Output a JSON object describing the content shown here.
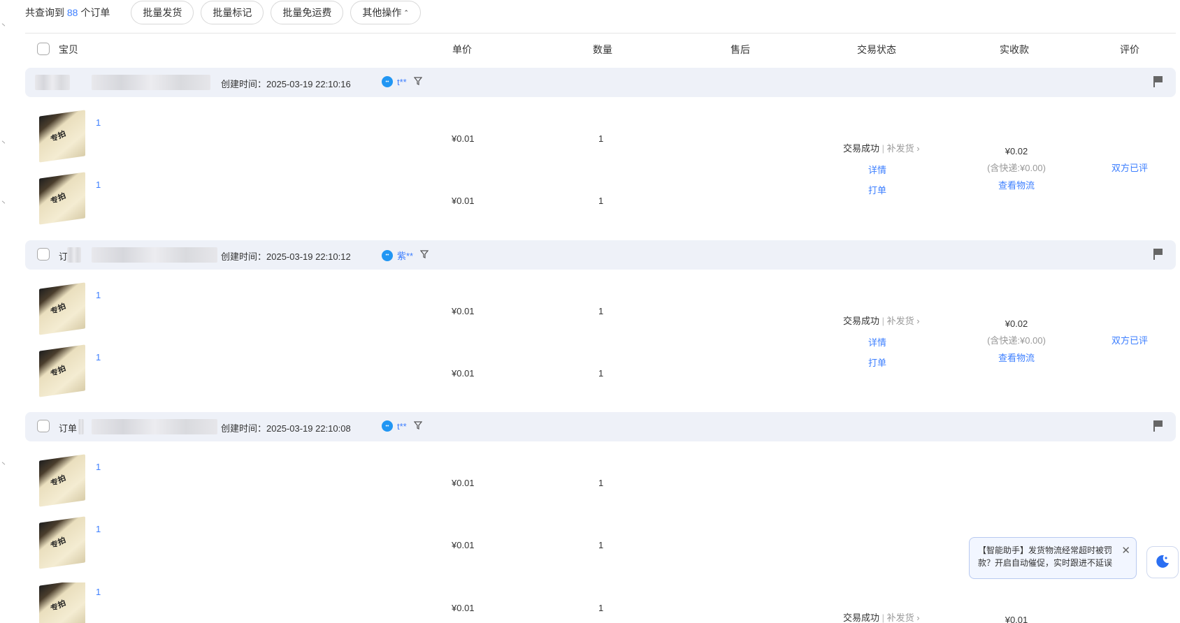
{
  "summary": {
    "prefix": "共查询到",
    "count": "88",
    "suffix": "个订单"
  },
  "toolbar": {
    "bulk_ship": "批量发货",
    "bulk_mark": "批量标记",
    "bulk_free_shipping": "批量免运费",
    "other_ops": "其他操作"
  },
  "columns": {
    "item": "宝贝",
    "unit_price": "单价",
    "quantity": "数量",
    "after_sale": "售后",
    "trade_status": "交易状态",
    "paid": "实收款",
    "review": "评价"
  },
  "orders": [
    {
      "order_label": "",
      "created": "创建时间：2025-03-19 22:10:16",
      "buyer": "t**",
      "items": [
        {
          "title": "1",
          "price": "¥0.01",
          "qty": "1"
        },
        {
          "title": "1",
          "price": "¥0.01",
          "qty": "1"
        }
      ],
      "status": "交易成功",
      "status_sep": "|",
      "status_sub": "补发货",
      "detail": "详情",
      "print": "打单",
      "amount": "¥0.02",
      "shipping": "(含快递:¥0.00)",
      "logistics": "查看物流",
      "review": "双方已评"
    },
    {
      "order_label": "订",
      "created": "创建时间：2025-03-19 22:10:12",
      "buyer": "紫**",
      "items": [
        {
          "title": "1",
          "price": "¥0.01",
          "qty": "1"
        },
        {
          "title": "1",
          "price": "¥0.01",
          "qty": "1"
        }
      ],
      "status": "交易成功",
      "status_sep": "|",
      "status_sub": "补发货",
      "detail": "详情",
      "print": "打单",
      "amount": "¥0.02",
      "shipping": "(含快递:¥0.00)",
      "logistics": "查看物流",
      "review": "双方已评"
    },
    {
      "order_label": "订单",
      "created": "创建时间：2025-03-19 22:10:08",
      "buyer": "t**",
      "items": [
        {
          "title": "1",
          "price": "¥0.01",
          "qty": "1"
        },
        {
          "title": "1",
          "price": "¥0.01",
          "qty": "1"
        },
        {
          "title": "1",
          "price": "¥0.01",
          "qty": "1"
        }
      ],
      "status": "交易成功",
      "status_sep": "|",
      "status_sub": "补发货",
      "amount": "¥0.01"
    }
  ],
  "thumb_text": "专拍",
  "assistant": {
    "text": "【智能助手】发货物流经常超时被罚款？开启自动催促，实时跟进不延误"
  },
  "colors": {
    "accent": "#3d7fff",
    "order_header_bg": "#eef1f8",
    "wangwang": "#2196f3"
  },
  "icons": [
    "wangwang-icon",
    "filter-icon",
    "flag-icon",
    "close-icon",
    "moon-icon",
    "chevron-right-icon",
    "caret-up-icon"
  ]
}
